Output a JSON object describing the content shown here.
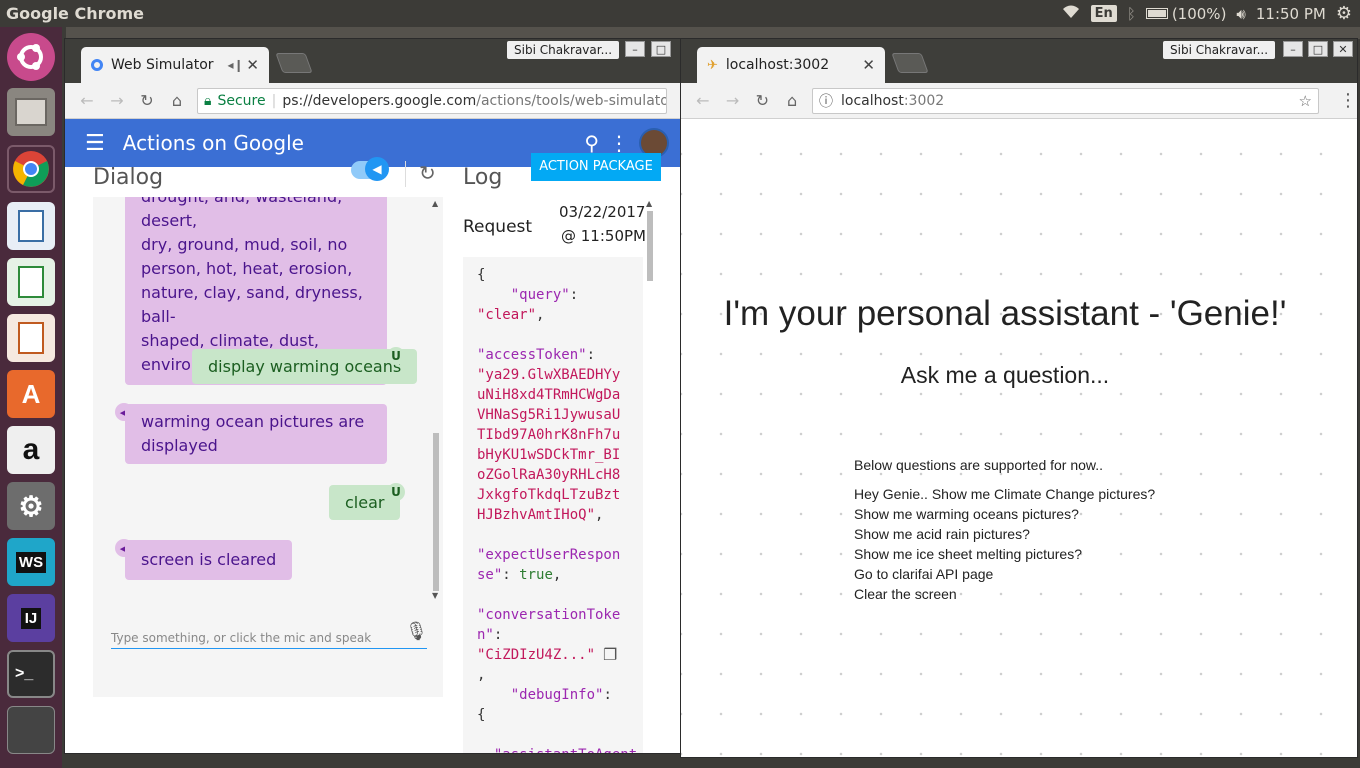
{
  "topbar": {
    "app_name": "Google Chrome",
    "lang": "En",
    "battery": "(100%)",
    "time": "11:50 PM"
  },
  "launcher": {
    "items": [
      "ubuntu-icon",
      "files-icon",
      "chrome-icon",
      "writer-icon",
      "calc-icon",
      "impress-icon",
      "software-center-icon",
      "amazon-icon",
      "settings-icon",
      "webstorm-icon",
      "intellij-icon",
      "terminal-icon",
      "workspaces-icon"
    ],
    "webstorm_label": "WS",
    "intellij_label": "IJ"
  },
  "left_window": {
    "tab_title": "Web Simulator",
    "user": "Sibi Chakravar...",
    "secure_label": "Secure",
    "url_main": "ps://developers.google.com",
    "url_rest": "/actions/tools/web-simulator",
    "app_header": {
      "title": "Actions on Google"
    },
    "action_button": "ACTION PACKAGE",
    "dialog": {
      "title": "Dialog",
      "first_bubble": [
        "drought, arid, wasteland, desert,",
        "dry, ground, mud, soil, no",
        "person, hot, heat, erosion,",
        "nature, clay, sand, dryness, ball-",
        "shaped, climate, dust,",
        "environment,"
      ],
      "user_msg_1": "display warming oceans",
      "agent_msg_1": [
        "warming ocean pictures are",
        "displayed"
      ],
      "user_msg_2": "clear",
      "agent_msg_2": "screen is cleared",
      "user_badge": "U",
      "input_placeholder": "Type something, or click the mic and speak"
    },
    "log": {
      "title": "Log",
      "request_label": "Request",
      "date": "03/22/2017",
      "time": "@ 11:50PM"
    }
  },
  "right_window": {
    "tab_title": "localhost:3002",
    "user": "Sibi Chakravar...",
    "url_host": "localhost",
    "url_port": ":3002",
    "heading": "I'm your personal assistant - 'Genie!'",
    "subheading": "Ask me a question...",
    "intro": "Below questions are supported for now..",
    "questions": [
      "Hey Genie.. Show me Climate Change pictures?",
      "Show me warming oceans pictures?",
      "Show me acid rain pictures?",
      "Show me ice sheet melting pictures?",
      "Go to clarifai API page",
      "Clear the screen"
    ]
  },
  "background_tab_hint": "Sibi Chakravar..."
}
